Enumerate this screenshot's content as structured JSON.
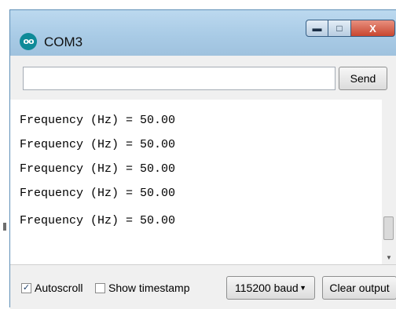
{
  "window": {
    "title": "COM3",
    "icon": "arduino-infinity-icon",
    "icon_text": "oo"
  },
  "controls": {
    "minimize": "minimize-icon",
    "maximize": "maximize-icon",
    "close": "close-icon",
    "minimize_glyph": "▬",
    "maximize_glyph": "□",
    "close_glyph": "X"
  },
  "input_bar": {
    "value": "",
    "send_label": "Send"
  },
  "output": {
    "lines": [
      "Frequency (Hz) = 50.00",
      "Frequency (Hz) = 50.00",
      "Frequency (Hz) = 50.00",
      "Frequency (Hz) = 50.00",
      "Frequency (Hz) = 50.00"
    ]
  },
  "bottom_bar": {
    "autoscroll": {
      "label": "Autoscroll",
      "checked": true,
      "mark": "✓"
    },
    "timestamp": {
      "label": "Show timestamp",
      "checked": false
    },
    "baud": "115200 baud",
    "baud_arrow": "▼",
    "clear_label": "Clear output"
  },
  "colors": {
    "titlebar": "#a9cbe6",
    "close_button": "#c8462f",
    "app_icon": "#0f8a98"
  }
}
